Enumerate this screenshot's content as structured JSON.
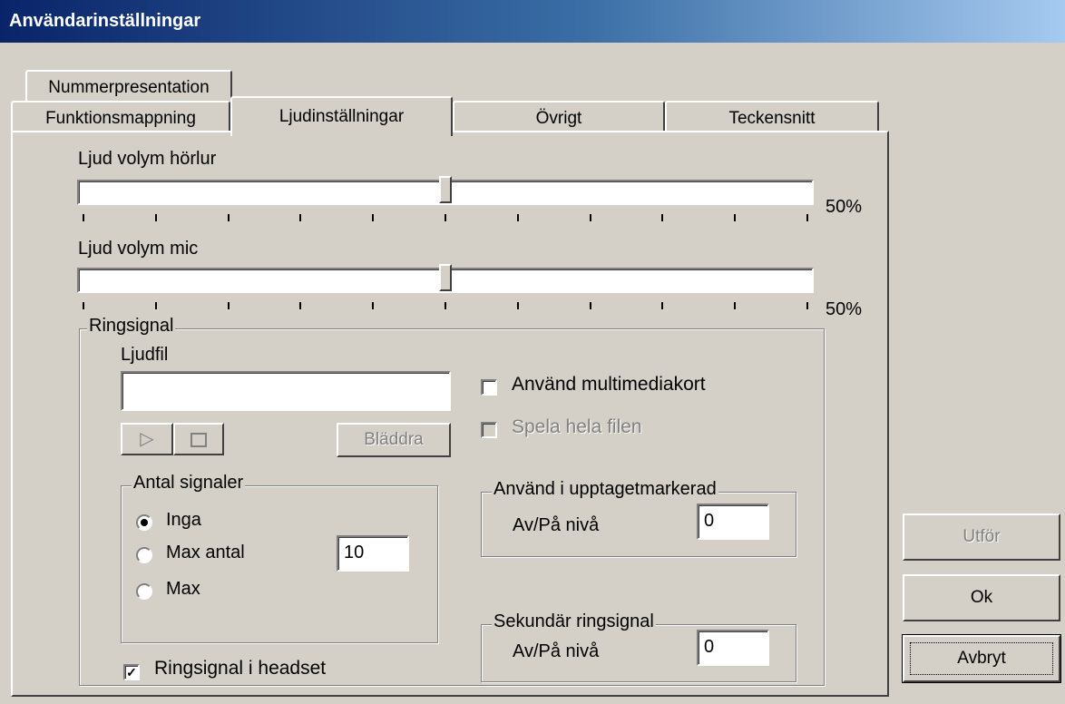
{
  "window": {
    "title": "Användarinställningar"
  },
  "tabs": {
    "row1": [
      {
        "label": "Nummerpresentation"
      }
    ],
    "row2": [
      {
        "label": "Funktionsmappning"
      },
      {
        "label": "Ljudinställningar",
        "active": true
      },
      {
        "label": "Övrigt"
      },
      {
        "label": "Teckensnitt"
      }
    ]
  },
  "sliders": {
    "headphone": {
      "label": "Ljud volym hörlur",
      "value": 50,
      "value_text": "50%"
    },
    "mic": {
      "label": "Ljud volym mic",
      "value": 50,
      "value_text": "50%"
    }
  },
  "ringsignal": {
    "legend": "Ringsignal",
    "ljudfil_label": "Ljudfil",
    "ljudfil_value": "",
    "play_icon": "play-icon",
    "stop_icon": "stop-icon",
    "browse_label": "Bläddra",
    "use_multimedia_label": "Använd multimediakort",
    "use_multimedia_checked": false,
    "play_whole_label": "Spela hela filen",
    "play_whole_checked": false,
    "antal": {
      "legend": "Antal signaler",
      "options": [
        "Inga",
        "Max antal",
        "Max"
      ],
      "selected": "Inga",
      "max_count_value": "10"
    },
    "headset_label": "Ringsignal i headset",
    "headset_checked": true,
    "upptaget": {
      "legend": "Använd i upptagetmarkerad",
      "level_label": "Av/På nivå",
      "level_value": "0"
    },
    "sekundar": {
      "legend": "Sekundär ringsignal",
      "level_label": "Av/På nivå",
      "level_value": "0"
    }
  },
  "buttons": {
    "apply": "Utför",
    "ok": "Ok",
    "cancel": "Avbryt"
  },
  "colors": {
    "face": "#d4d0c8",
    "title_start": "#0a246a",
    "title_end": "#a6caf0",
    "disabled": "#808080"
  }
}
